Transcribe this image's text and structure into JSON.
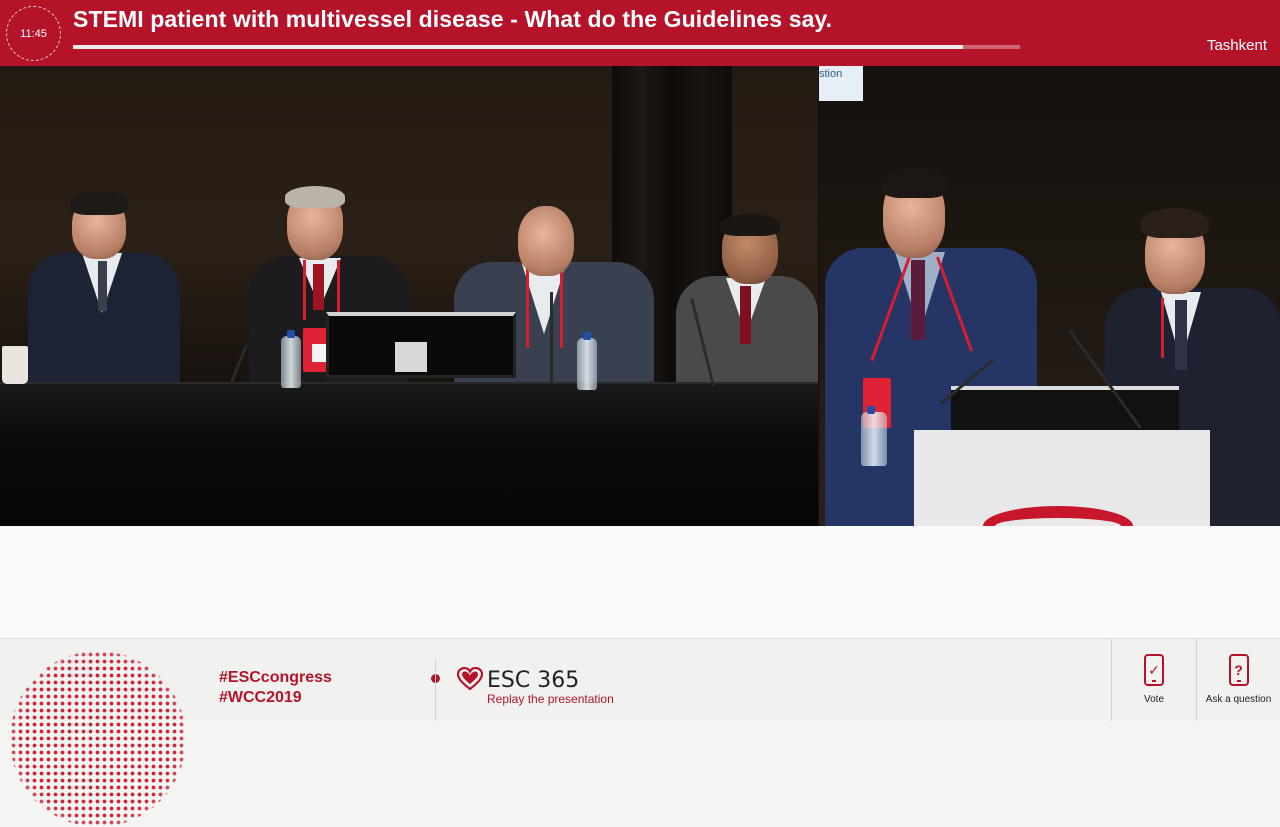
{
  "header": {
    "clock": "11:45",
    "title": "STEMI patient with multivessel disease - What do the Guidelines say.",
    "progress": 0.94,
    "location": "Tashkent"
  },
  "video": {
    "slide_fragment_text": "stion"
  },
  "footer": {
    "hashtags": [
      "#ESCcongress",
      "#WCC2019"
    ],
    "esc365": {
      "title": "ESC 365",
      "subtitle": "Replay the presentation"
    },
    "tools": {
      "vote_label": "Vote",
      "ask_label": "Ask a question",
      "ask_glyph": "?"
    }
  },
  "colors": {
    "brand_red": "#b5132a",
    "header_text": "#ffffff"
  },
  "icons": {
    "vote": "phone-check-icon",
    "ask": "phone-question-icon",
    "esc": "heart-logo-icon"
  }
}
